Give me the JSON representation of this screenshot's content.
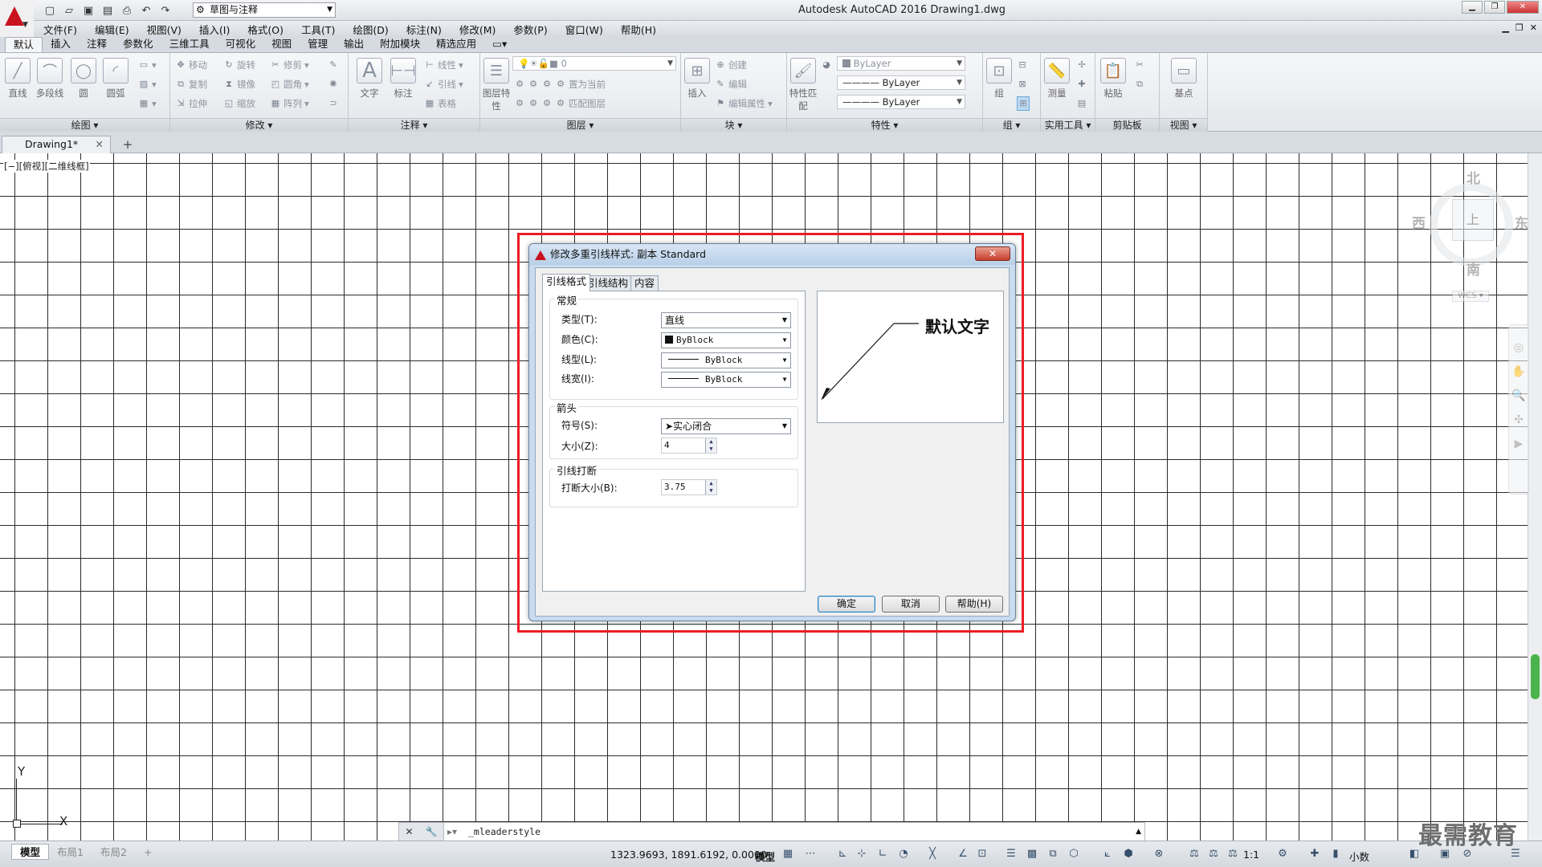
{
  "app": {
    "title": "Autodesk AutoCAD 2016    Drawing1.dwg",
    "workspace": "草图与注释"
  },
  "menu": [
    "文件(F)",
    "编辑(E)",
    "视图(V)",
    "插入(I)",
    "格式(O)",
    "工具(T)",
    "绘图(D)",
    "标注(N)",
    "修改(M)",
    "参数(P)",
    "窗口(W)",
    "帮助(H)"
  ],
  "ribbon_tabs": [
    "默认",
    "插入",
    "注释",
    "参数化",
    "三维工具",
    "可视化",
    "视图",
    "管理",
    "输出",
    "附加模块",
    "精选应用"
  ],
  "ribbon": {
    "draw": {
      "title": "绘图",
      "line": "直线",
      "polyline": "多段线",
      "circle": "圆",
      "arc": "圆弧"
    },
    "modify": {
      "title": "修改",
      "move": "移动",
      "rotate": "旋转",
      "trim": "修剪",
      "copy": "复制",
      "mirror": "镜像",
      "fillet": "圆角",
      "stretch": "拉伸",
      "scale": "缩放",
      "array": "阵列"
    },
    "annotation": {
      "title": "注释",
      "text": "文字",
      "dimension": "标注",
      "linear": "线性",
      "leader": "引线",
      "table": "表格"
    },
    "layers": {
      "title": "图层",
      "props": "图层特性",
      "layer_value": "0",
      "make_current": "置为当前",
      "match_layer": "匹配图层"
    },
    "block": {
      "title": "块",
      "insert": "插入",
      "create": "创建",
      "edit": "编辑",
      "edit_attr": "编辑属性"
    },
    "properties": {
      "title": "特性",
      "match": "特性匹配",
      "color": "ByLayer",
      "linetype": "ByLayer",
      "lineweight": "ByLayer"
    },
    "group": {
      "title": "组",
      "group": "组"
    },
    "utilities": {
      "title": "实用工具",
      "measure": "测量"
    },
    "clipboard": {
      "title": "剪贴板",
      "paste": "粘贴"
    },
    "view": {
      "title": "视图",
      "base": "基点"
    }
  },
  "doc_tab": "Drawing1*",
  "viewport_label": "[−][俯视][二维线框]",
  "viewcube": {
    "north": "北",
    "south": "南",
    "east": "东",
    "west": "西",
    "face": "上",
    "wcs": "WCS"
  },
  "ucs": {
    "x": "X",
    "y": "Y"
  },
  "command_line": {
    "text": "_mleaderstyle"
  },
  "status": {
    "layouts": [
      "模型",
      "布局1",
      "布局2"
    ],
    "coords": "1323.9693, 1891.6192, 0.0000",
    "model": "模型",
    "scale": "1:1",
    "units": "小数"
  },
  "watermark": "最需教育",
  "dialog": {
    "title": "修改多重引线样式: 副本 Standard",
    "tabs": [
      "引线格式",
      "引线结构",
      "内容"
    ],
    "general": {
      "title": "常规",
      "type_label": "类型(T):",
      "type_value": "直线",
      "color_label": "颜色(C):",
      "color_value": "ByBlock",
      "linetype_label": "线型(L):",
      "linetype_value": "ByBlock",
      "lineweight_label": "线宽(I):",
      "lineweight_value": "ByBlock"
    },
    "arrowhead": {
      "title": "箭头",
      "symbol_label": "符号(S):",
      "symbol_value": "实心闭合",
      "size_label": "大小(Z):",
      "size_value": "4"
    },
    "landing_break": {
      "title": "引线打断",
      "break_label": "打断大小(B):",
      "break_value": "3.75"
    },
    "preview_text": "默认文字",
    "ok": "确定",
    "cancel": "取消",
    "help": "帮助(H)"
  },
  "colors": {
    "highlight": "#ed1c24",
    "autocad_red": "#c8121d",
    "dialog_frame": "#c9dbef"
  }
}
